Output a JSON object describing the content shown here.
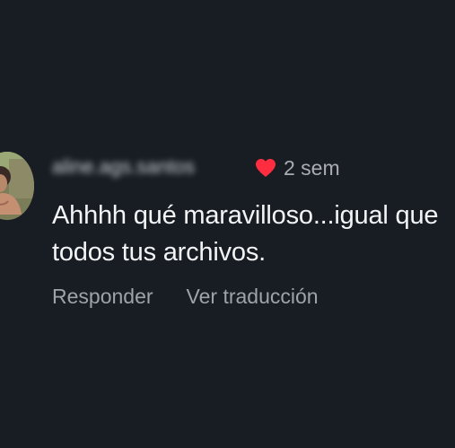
{
  "comment": {
    "username": "aline.ags.santos",
    "time": "2 sem",
    "liked_icon": "heart-icon",
    "text": "Ahhhh qué maravilloso...igual que todos tus archivos.",
    "actions": {
      "reply_label": "Responder",
      "translate_label": "Ver traducción"
    }
  },
  "colors": {
    "background": "#181d24",
    "heart": "#ff2d3f",
    "text": "#f3f4f6",
    "secondary_text": "#9ea3aa"
  }
}
